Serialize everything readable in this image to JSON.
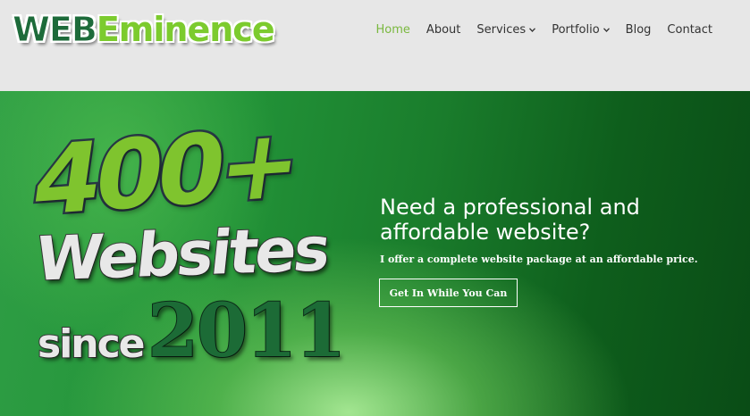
{
  "header": {
    "logo": {
      "part1": "WEB",
      "part2": "Eminence"
    },
    "nav": [
      {
        "label": "Home",
        "active": true,
        "dropdown": false
      },
      {
        "label": "About",
        "active": false,
        "dropdown": false
      },
      {
        "label": "Services",
        "active": false,
        "dropdown": true
      },
      {
        "label": "Portfolio",
        "active": false,
        "dropdown": true
      },
      {
        "label": "Blog",
        "active": false,
        "dropdown": false
      },
      {
        "label": "Contact",
        "active": false,
        "dropdown": false
      }
    ],
    "chevron": "⌄",
    "colors": {
      "active": "#7ab83f",
      "text": "#333333",
      "background": "#e7e7e7"
    }
  },
  "hero": {
    "graphic": {
      "count": "400+",
      "word": "Websites",
      "since": "since",
      "year": "2011"
    },
    "headline_line1": "Need a professional and",
    "headline_line2": "affordable website?",
    "subline": "I offer a complete website package at an affordable price.",
    "cta_label": "Get In While You Can",
    "colors": {
      "green_light": "#7fc42e",
      "green_dark": "#1c6b36",
      "bg_dark": "#0a4c16"
    }
  }
}
